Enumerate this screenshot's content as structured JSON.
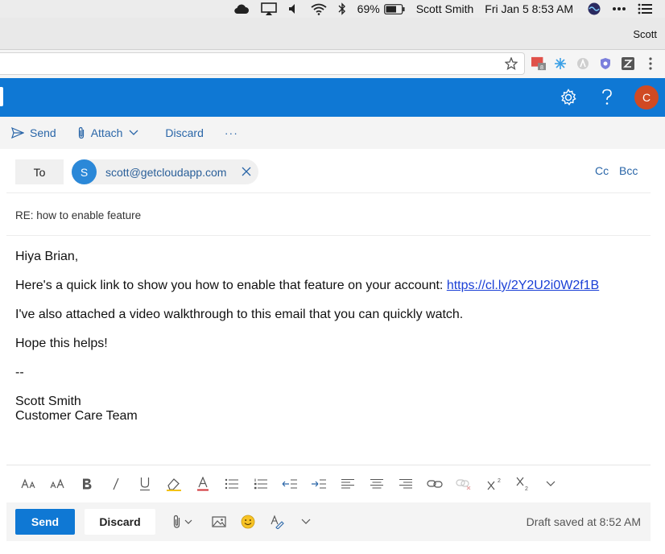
{
  "menubar": {
    "battery": "69%",
    "user": "Scott Smith",
    "datetime": "Fri Jan 5  8:53 AM"
  },
  "browser": {
    "profile_name": "Scott",
    "extension_badge": "8"
  },
  "header": {
    "avatar_initial": "C",
    "accent_color": "#0f78d4",
    "avatar_color": "#d04a23"
  },
  "commands": {
    "send": "Send",
    "attach": "Attach",
    "discard": "Discard",
    "more": "···"
  },
  "recipients": {
    "to_label": "To",
    "chip_initial": "S",
    "chip_email": "scott@getcloudapp.com",
    "cc_label": "Cc",
    "bcc_label": "Bcc"
  },
  "subject": "RE: how to enable feature",
  "message": {
    "greeting": "Hiya Brian,",
    "line1_text": "Here's a quick link to show you how to enable that feature on your account: ",
    "link": "https://cl.ly/2Y2U2i0W2f1B",
    "line2": "I've also attached a video walkthrough to this email that you can quickly watch.",
    "line3": "Hope this helps!",
    "separator": "--",
    "sig_name": "Scott Smith",
    "sig_team": "Customer Care Team"
  },
  "actions": {
    "send": "Send",
    "discard": "Discard",
    "draft_status": "Draft saved at 8:52 AM"
  }
}
